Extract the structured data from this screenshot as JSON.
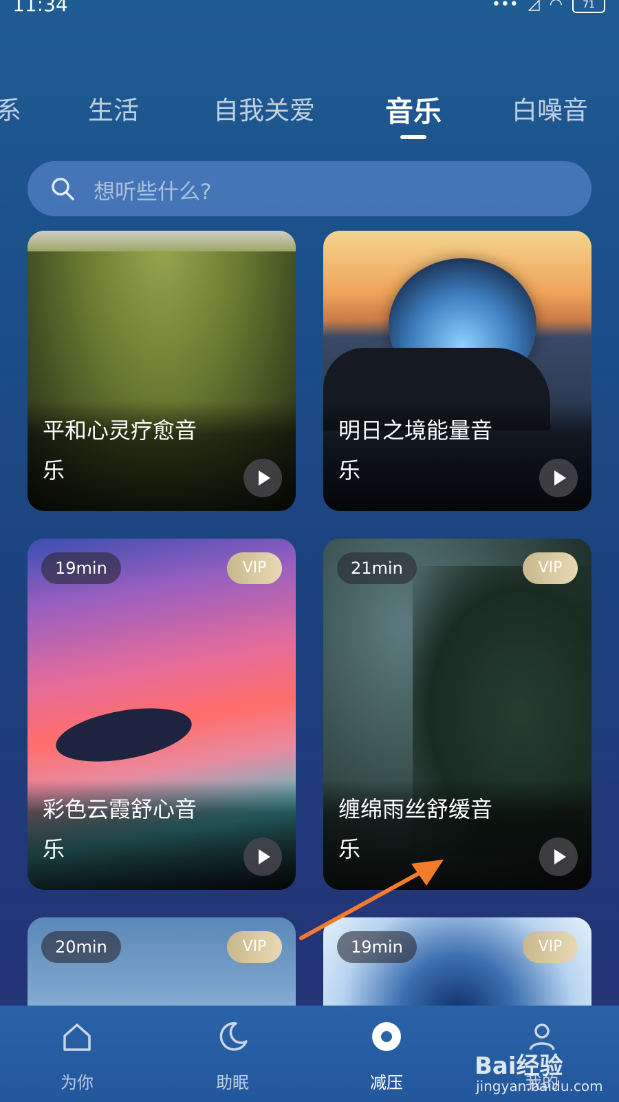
{
  "status": {
    "time": "11:34",
    "battery": "71"
  },
  "tabs": [
    {
      "label": "系"
    },
    {
      "label": "生活"
    },
    {
      "label": "自我关爱"
    },
    {
      "label": "音乐",
      "active": true
    },
    {
      "label": "白噪音"
    }
  ],
  "search": {
    "placeholder": "想听些什么?"
  },
  "cards": [
    {
      "title_line1": "平和心灵疗愈音",
      "title_line2": "乐",
      "duration": "",
      "vip": ""
    },
    {
      "title_line1": "明日之境能量音",
      "title_line2": "乐",
      "duration": "",
      "vip": ""
    },
    {
      "title_line1": "彩色云霞舒心音",
      "title_line2": "乐",
      "duration": "19min",
      "vip": "VIP"
    },
    {
      "title_line1": "缠绵雨丝舒缓音",
      "title_line2": "乐",
      "duration": "21min",
      "vip": "VIP"
    },
    {
      "title_line1": "",
      "title_line2": "",
      "duration": "20min",
      "vip": "VIP"
    },
    {
      "title_line1": "",
      "title_line2": "",
      "duration": "19min",
      "vip": "VIP"
    }
  ],
  "bottom_nav": [
    {
      "label": "为你",
      "icon": "home-icon"
    },
    {
      "label": "助眠",
      "icon": "moon-icon"
    },
    {
      "label": "减压",
      "icon": "relax-icon",
      "active": true
    },
    {
      "label": "我的",
      "icon": "profile-icon"
    }
  ],
  "watermark": {
    "brand": "Bai经验",
    "url": "jingyan.baidu.com"
  },
  "colors": {
    "accent": "#ffffff",
    "vip_gold": "#d8c79d",
    "nav_bg": "#2a62a8"
  }
}
